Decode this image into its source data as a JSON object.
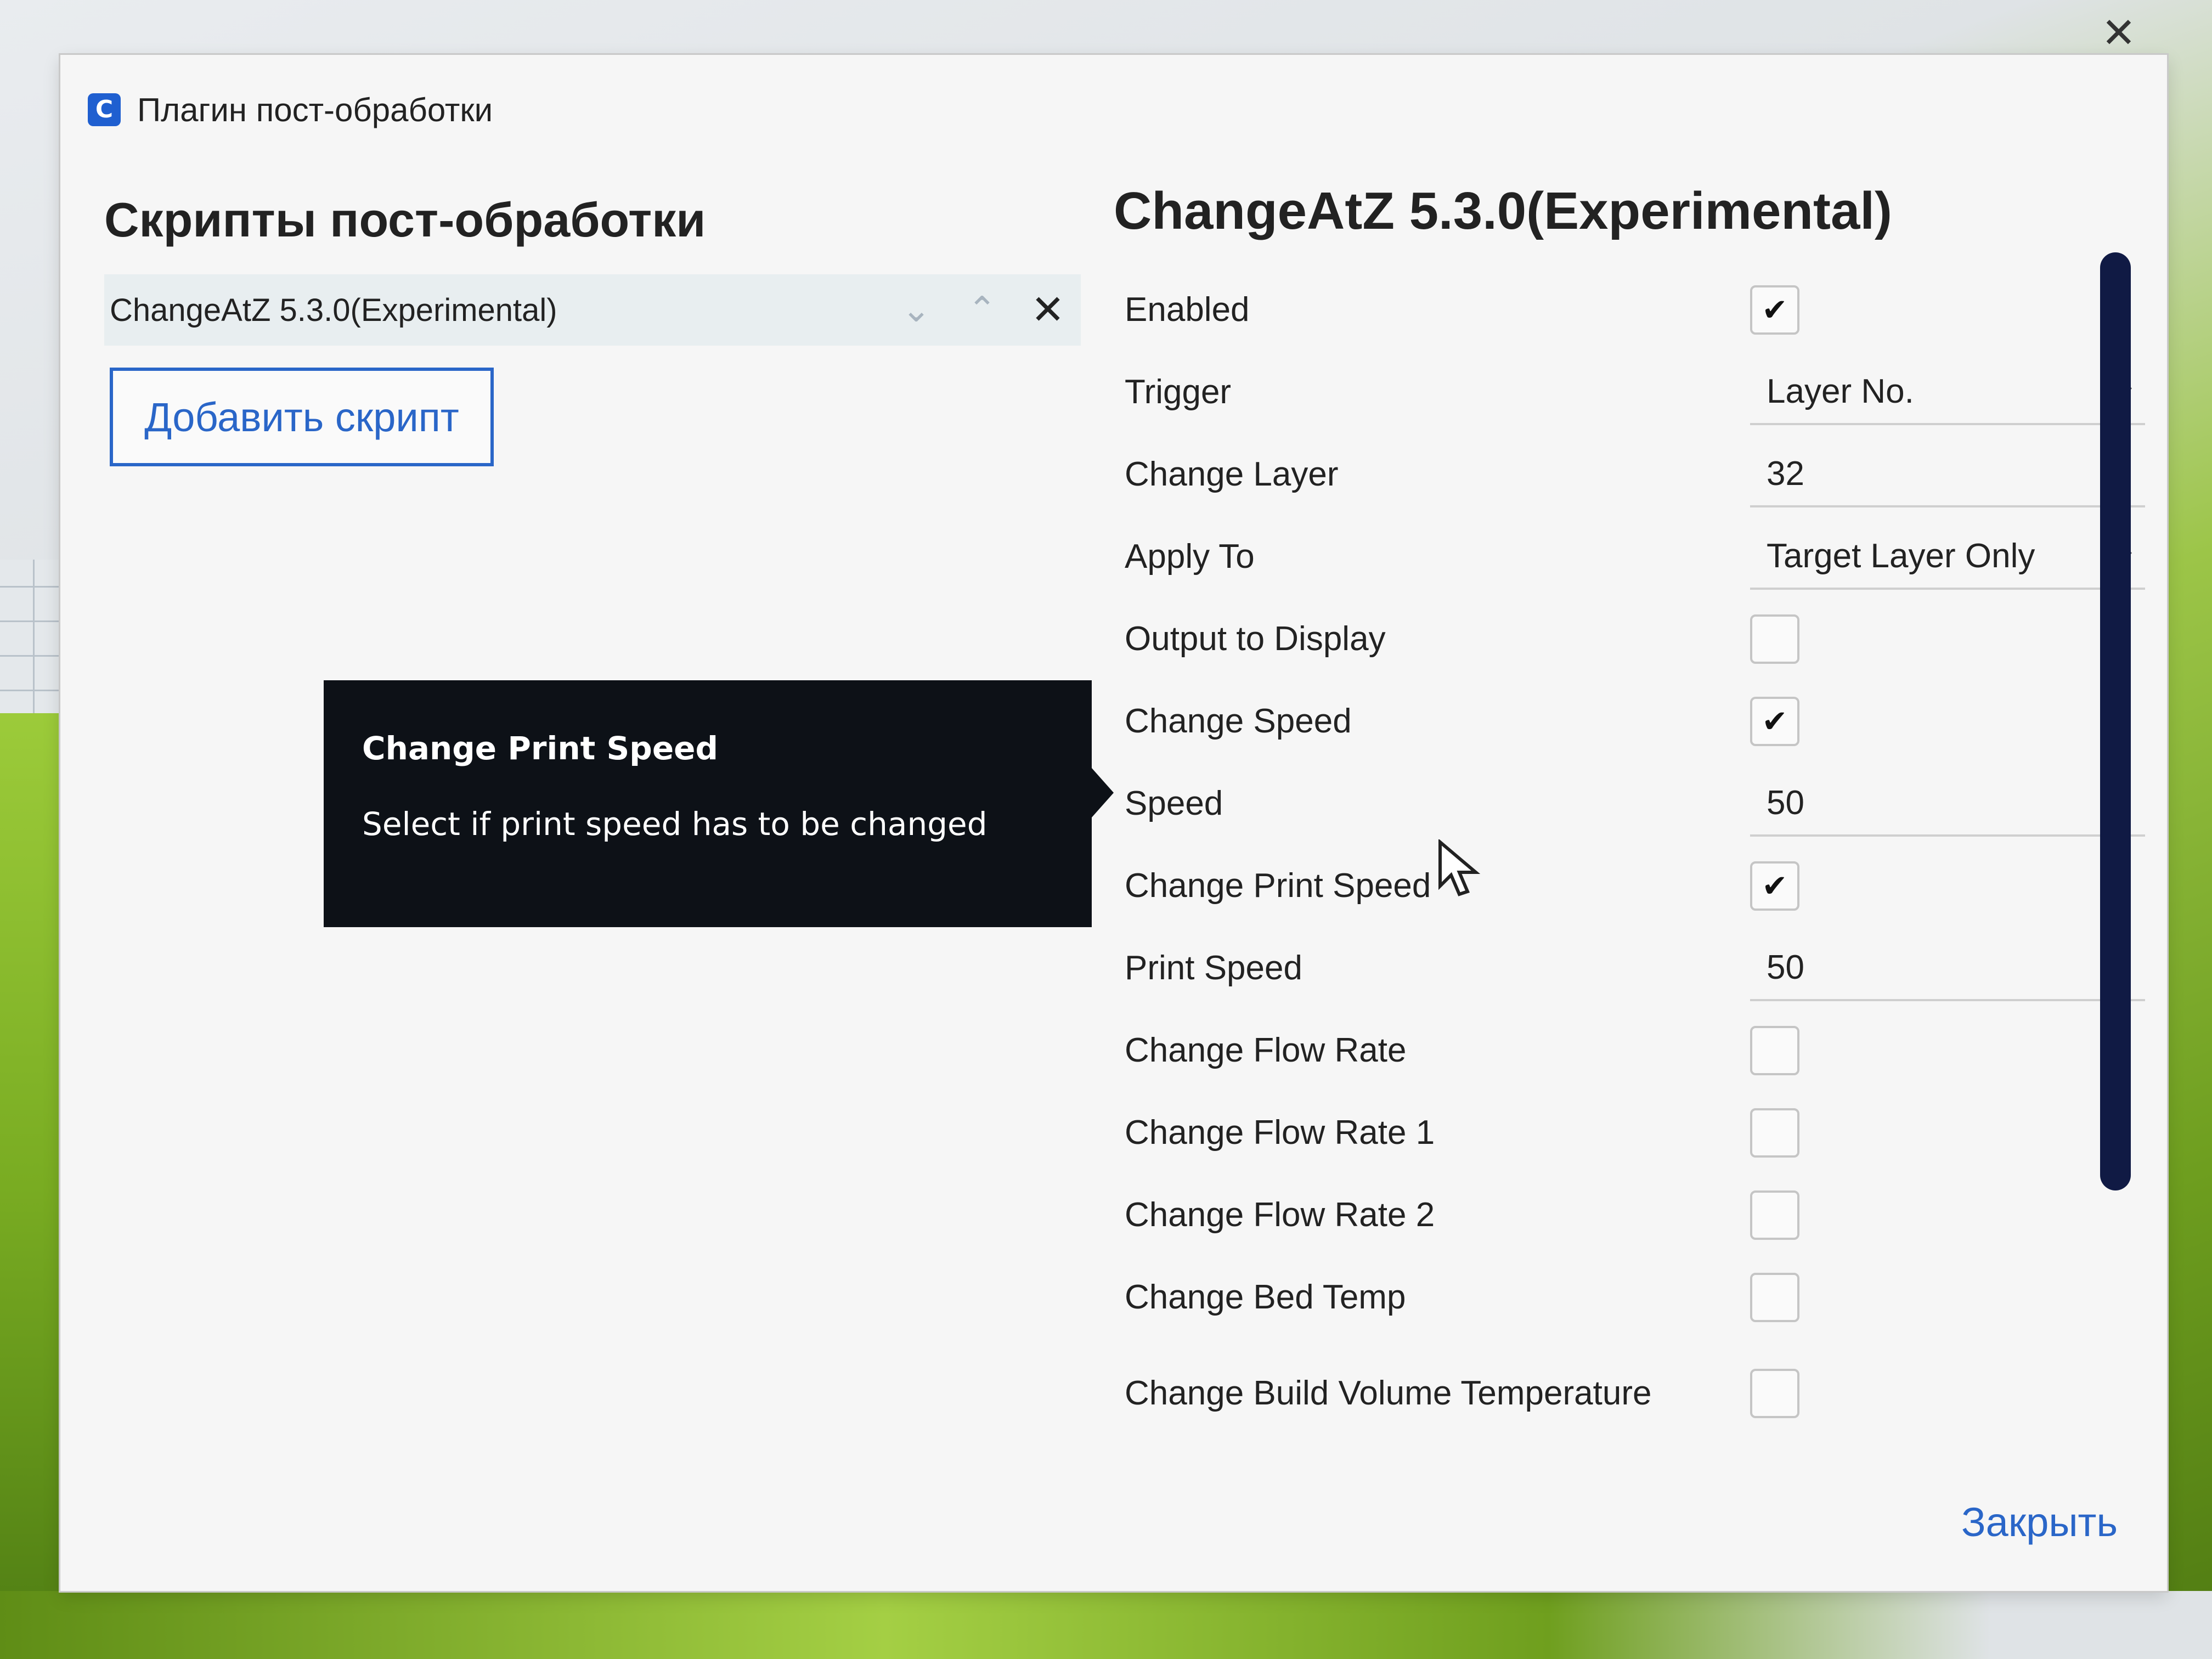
{
  "window": {
    "title": "Плагин пост-обработки",
    "icon": "cura-icon",
    "close_glyph": "✕"
  },
  "scripts_panel": {
    "heading": "Скрипты пост-обработки",
    "scripts": [
      {
        "name": "ChangeAtZ 5.3.0(Experimental)"
      }
    ],
    "move_down_glyph": "⌄",
    "move_up_glyph": "⌃",
    "remove_glyph": "✕",
    "add_button_label": "Добавить скрипт"
  },
  "tooltip": {
    "title": "Change Print Speed",
    "text": "Select if print speed has to be changed"
  },
  "settings_panel": {
    "title": "ChangeAtZ 5.3.0(Experimental)",
    "items": [
      {
        "label": "Enabled",
        "type": "checkbox",
        "checked": true,
        "glyph": "✔"
      },
      {
        "label": "Trigger",
        "type": "select",
        "value": "Layer No."
      },
      {
        "label": "Change Layer",
        "type": "field",
        "value": "32"
      },
      {
        "label": "Apply To",
        "type": "select",
        "value": "Target Layer Only"
      },
      {
        "label": "Output to Display",
        "type": "checkbox",
        "checked": false,
        "glyph": ""
      },
      {
        "label": "Change Speed",
        "type": "checkbox",
        "checked": true,
        "glyph": "✔"
      },
      {
        "label": "Speed",
        "type": "field",
        "value": "50"
      },
      {
        "label": "Change Print Speed",
        "type": "checkbox",
        "checked": true,
        "glyph": "✔"
      },
      {
        "label": "Print Speed",
        "type": "field",
        "value": "50"
      },
      {
        "label": "Change Flow Rate",
        "type": "checkbox",
        "checked": false,
        "glyph": ""
      },
      {
        "label": "Change Flow Rate 1",
        "type": "checkbox",
        "checked": false,
        "glyph": ""
      },
      {
        "label": "Change Flow Rate 2",
        "type": "checkbox",
        "checked": false,
        "glyph": ""
      },
      {
        "label": "Change Bed Temp",
        "type": "checkbox",
        "checked": false,
        "glyph": ""
      },
      {
        "label": "Change Build Volume Temperature",
        "type": "checkbox",
        "checked": false,
        "glyph": ""
      }
    ]
  },
  "footer": {
    "close_label": "Закрыть"
  },
  "colors": {
    "accent": "#2a66c8",
    "tooltip_bg": "#0d1117",
    "scrollbar": "#101a44",
    "dialog_bg": "#f6f6f6"
  }
}
